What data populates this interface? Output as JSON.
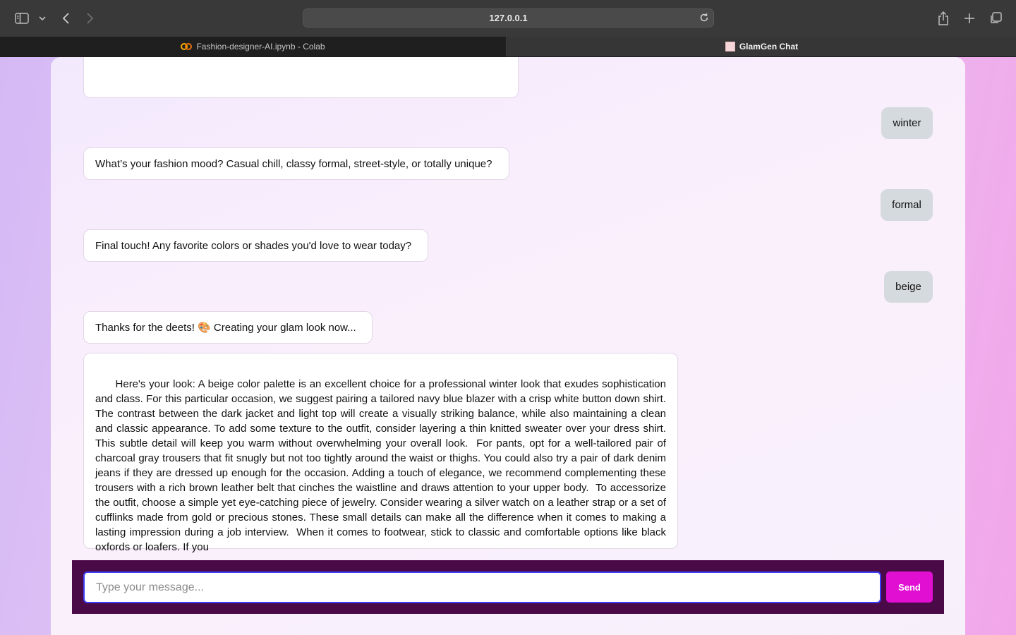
{
  "browser": {
    "address": "127.0.0.1",
    "tabs": [
      {
        "title": "Fashion-designer-AI.ipynb - Colab",
        "active": false
      },
      {
        "title": "GlamGen Chat",
        "active": true
      }
    ]
  },
  "chat": {
    "messages": [
      {
        "role": "user",
        "text": "winter"
      },
      {
        "role": "bot",
        "text": "What’s your fashion mood? Casual chill, classy formal, street-style, or totally unique?"
      },
      {
        "role": "user",
        "text": "formal"
      },
      {
        "role": "bot",
        "text": "Final touch! Any favorite colors or shades you'd love to wear today?"
      },
      {
        "role": "user",
        "text": "beige"
      },
      {
        "role": "bot",
        "text": "Thanks for the deets! 🎨 Creating your glam look now..."
      },
      {
        "role": "bot",
        "text": "Here's your look: A beige color palette is an excellent choice for a professional winter look that exudes sophistication and class. For this particular occasion, we suggest pairing a tailored navy blue blazer with a crisp white button down shirt. The contrast between the dark jacket and light top will create a visually striking balance, while also maintaining a clean and classic appearance. To add some texture to the outfit, consider layering a thin knitted sweater over your dress shirt. This subtle detail will keep you warm without overwhelming your overall look.  For pants, opt for a well-tailored pair of charcoal gray trousers that fit snugly but not too tightly around the waist or thighs. You could also try a pair of dark denim jeans if they are dressed up enough for the occasion. Adding a touch of elegance, we recommend complementing these trousers with a rich brown leather belt that cinches the waistline and draws attention to your upper body.  To accessorize the outfit, choose a simple yet eye-catching piece of jewelry. Consider wearing a silver watch on a leather strap or a set of cufflinks made from gold or precious stones. These small details can make all the difference when it comes to making a lasting impression during a job interview.  When it comes to footwear, stick to classic and comfortable options like black oxfords or loafers. If you"
      }
    ]
  },
  "composer": {
    "placeholder": "Type your message...",
    "send_label": "Send"
  },
  "colors": {
    "accent": "#e10fd2",
    "panel": "#4a0a48",
    "user_bubble": "#d5dade"
  }
}
